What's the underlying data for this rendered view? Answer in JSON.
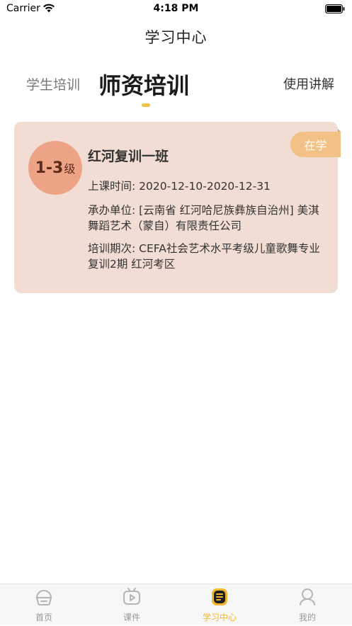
{
  "status_bar": {
    "carrier": "Carrier",
    "time": "4:18 PM"
  },
  "nav": {
    "title": "学习中心"
  },
  "segments": {
    "student_tab": "学生培训",
    "teacher_tab": "师资培训",
    "active": "teacher",
    "guide_link": "使用讲解"
  },
  "course": {
    "status_tag": "在学",
    "level_number": "1-3",
    "level_unit": "级",
    "name": "红河复训一班",
    "time_label": "上课时间:",
    "time_value": "2020-12-10-2020-12-31",
    "org_label": "承办单位:",
    "org_value": "[云南省 红河哈尼族彝族自治州] 美淇舞蹈艺术（蒙自）有限责任公司",
    "period_label": "培训期次:",
    "period_value": "CEFA社会艺术水平考级儿童歌舞专业 复训2期 红河考区"
  },
  "tab_bar": {
    "items": [
      {
        "label": "首页",
        "icon": "home-icon"
      },
      {
        "label": "课件",
        "icon": "courseware-icon"
      },
      {
        "label": "学习中心",
        "icon": "study-center-icon"
      },
      {
        "label": "我的",
        "icon": "profile-icon"
      }
    ],
    "active_index": 2
  },
  "colors": {
    "accent": "#f2b630",
    "card_bg": "#f2ddd4",
    "badge_bg": "#eda486",
    "tag_bg": "#f2c185"
  }
}
